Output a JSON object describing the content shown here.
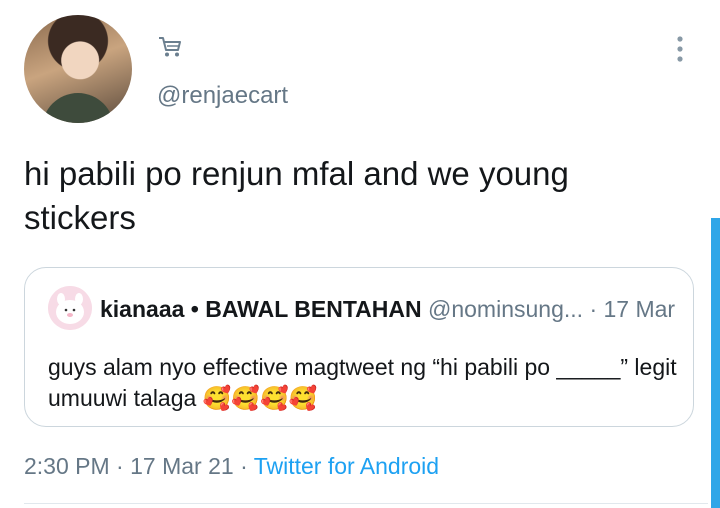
{
  "tweet": {
    "handle": "@renjaecart",
    "text": "hi pabili po renjun mfal and we young stickers",
    "time": "2:30 PM",
    "date": "17 Mar 21",
    "source": "Twitter for Android"
  },
  "quote": {
    "name": "kianaaa • BAWAL BENTAHAN",
    "handle": "@nominsung...",
    "date": "17 Mar",
    "text": "guys alam nyo effective magtweet ng “hi pabili po _____” legit umuuwi talaga 🥰🥰🥰🥰"
  },
  "meta": {
    "separator": "·"
  },
  "icons": {
    "cart": "shopping-cart-icon",
    "more": "more-vertical-icon",
    "avatar": "profile-photo"
  },
  "colors": {
    "link": "#1da1f2",
    "muted": "#657786",
    "text": "#14171a",
    "border": "#ccd6dd",
    "scroll_accent": "#2fa6e8"
  }
}
